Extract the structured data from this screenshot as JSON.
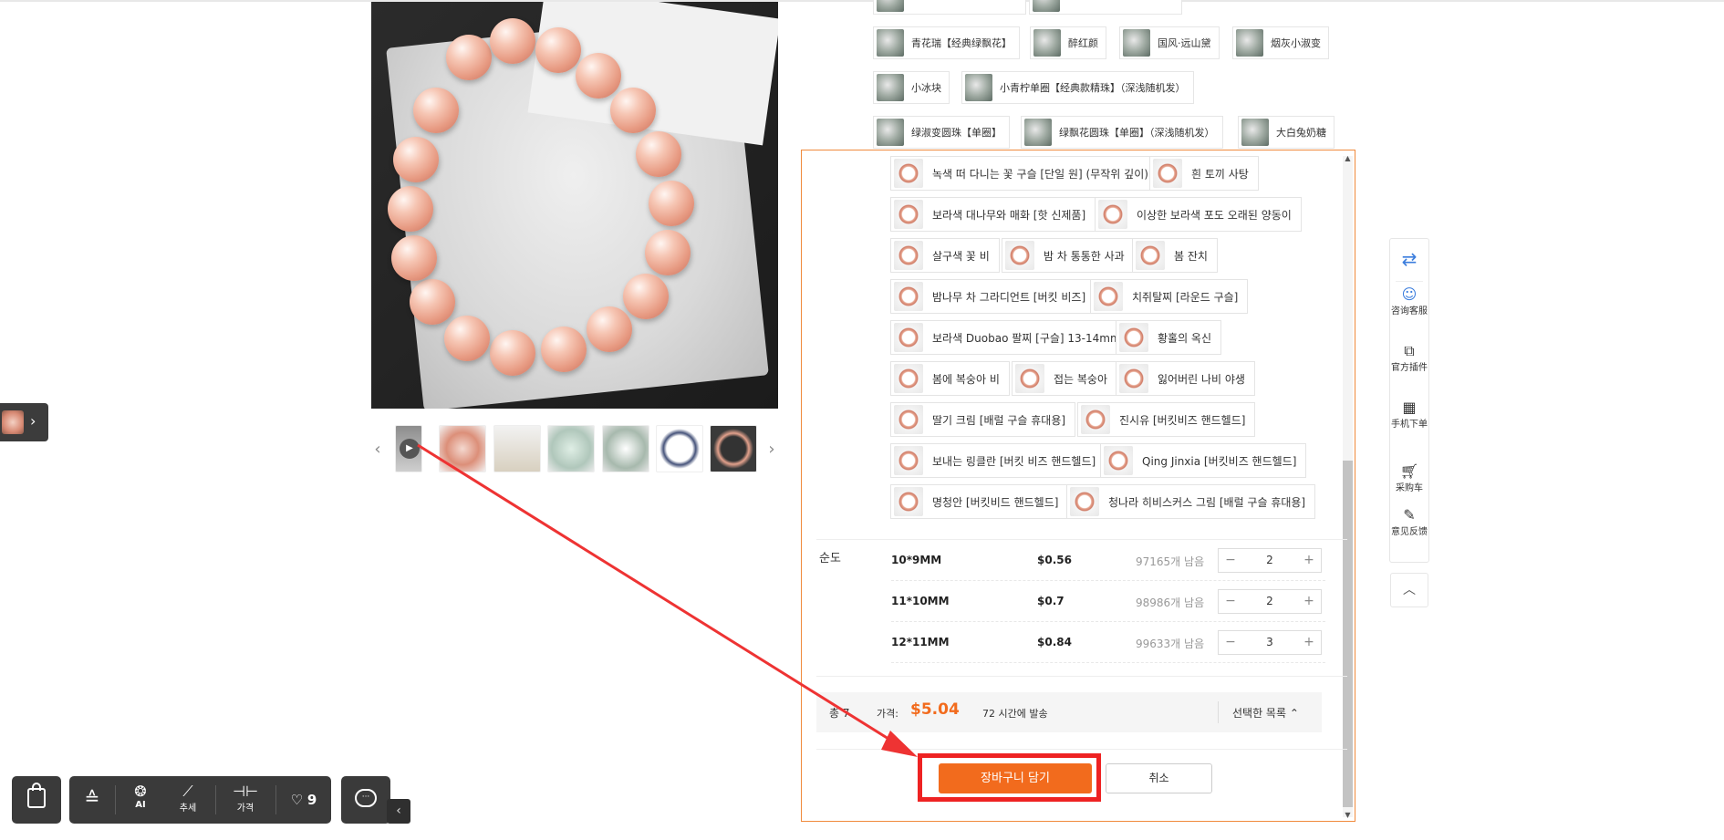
{
  "thumbnails": {
    "prev_arrow": "‹",
    "next_arrow": "›"
  },
  "variant_tags_bg": [
    "青花瑞【经典绿飘花】",
    "醉红颜",
    "国风·远山黛",
    "烟灰小淑变",
    "小冰块",
    "小青柠单圈【经典款精珠】（深浅随机发）",
    "绿淑变圆珠【单圈】",
    "绿飘花圆珠【单圈】（深浅随机发）",
    "大白兔奶糖"
  ],
  "sku_panel": {
    "options": [
      "녹색 떠 다니는 꽃 구슬 [단일 원] (무작위 깊이)",
      "흰 토끼 사탕",
      "보라색 대나무와 매화 [핫 신제품]",
      "이상한 보라색 포도 오래된 양동이",
      "살구색 꽃 비",
      "밤 차 통통한 사과",
      "봄 잔치",
      "밤나무 차 그라디언트 [버킷 비즈]",
      "치쥐탈찌 [라운드 구슬]",
      "보라색 Duobao 팔찌 [구슬] 13-14mm",
      "황홀의 옥신",
      "봄에 복숭아 비",
      "접는 복숭아",
      "잃어버린 나비 야생",
      "딸기 크림 [배럴 구슬 휴대용]",
      "진시유 [버킷비즈 핸드헬드]",
      "보내는 링클란 [버킷 비즈 핸드헬드]",
      "Qing Jinxia [버킷비즈 핸드헬드]",
      "명청안 [버킷비드 핸드헬드]",
      "청나라 히비스커스 그림 [배럴 구슬 휴대용]"
    ],
    "size_label": "순도",
    "sizes": [
      {
        "name": "10*9MM",
        "price": "$0.56",
        "stock": "97165개 남음",
        "qty": "2"
      },
      {
        "name": "11*10MM",
        "price": "$0.7",
        "stock": "98986개 남음",
        "qty": "2"
      },
      {
        "name": "12*11MM",
        "price": "$0.84",
        "stock": "99633개 남음",
        "qty": "3"
      }
    ],
    "stepper_minus": "−",
    "stepper_plus": "+",
    "total_prefix": "총 7",
    "price_label": "가격:",
    "total_price": "$5.04",
    "shipping": "72 시간에 발송",
    "selected_list": "선택한 목록 ⌃",
    "add_to_cart": "장바구니 담기",
    "cancel": "취소"
  },
  "right_toolbar": {
    "items": [
      {
        "icon": "translate-icon",
        "label": ""
      },
      {
        "icon": "support-icon",
        "label": "咨询客服"
      },
      {
        "icon": "plugin-icon",
        "label": "官方插件"
      },
      {
        "icon": "qrcode-icon",
        "label": "手机下单"
      },
      {
        "icon": "cart-icon",
        "label": "采购车"
      },
      {
        "icon": "feedback-icon",
        "label": "意见反馈"
      }
    ],
    "back_to_top": "︿"
  },
  "bottom_toolbar": {
    "ai_label": "AI",
    "trend_label": "추세",
    "price_label": "가격",
    "favorites_count": "9",
    "heart": "♡"
  },
  "colors": {
    "accent": "#f26b1d",
    "highlight": "#ee2222",
    "panel_border": "#f08a3c",
    "toolbar_bg": "#3a3a3a"
  }
}
